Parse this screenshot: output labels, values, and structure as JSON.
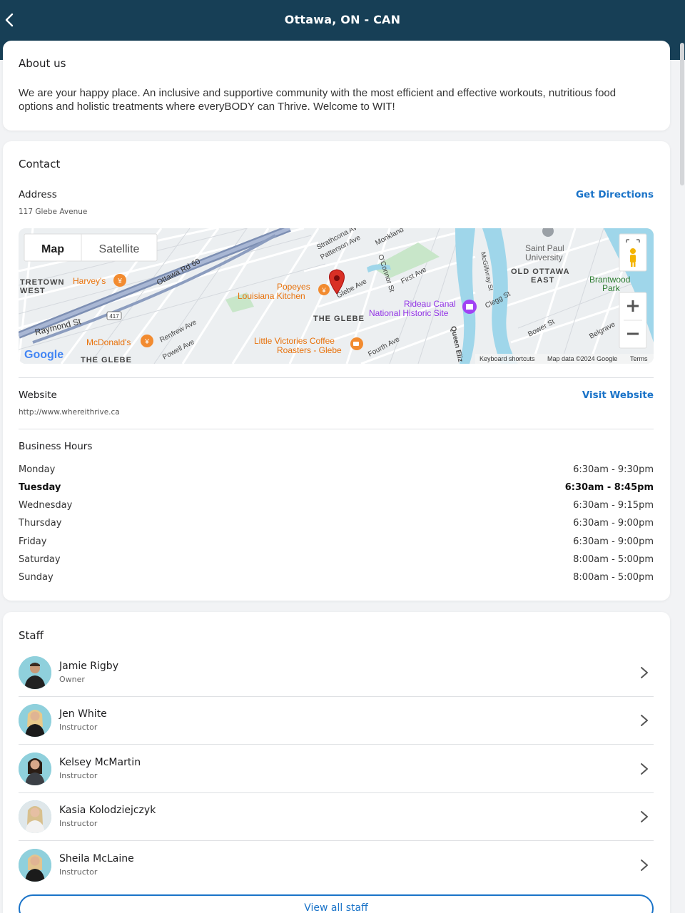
{
  "header": {
    "title": "Ottawa, ON - CAN"
  },
  "about": {
    "title": "About us",
    "text": "We are your happy place. An inclusive and supportive community with the most efficient and effective workouts, nutritious food options and holistic treatments where everyBODY can Thrive. Welcome to WIT!"
  },
  "contact": {
    "title": "Contact",
    "address_label": "Address",
    "address_value": "117 Glebe Avenue",
    "directions_label": "Get Directions",
    "website_label": "Website",
    "website_value": "http://www.whereithrive.ca",
    "visit_label": "Visit Website",
    "hours_label": "Business Hours",
    "hours": [
      {
        "day": "Monday",
        "time": "6:30am - 9:30pm"
      },
      {
        "day": "Tuesday",
        "time": "6:30am - 8:45pm"
      },
      {
        "day": "Wednesday",
        "time": "6:30am - 9:15pm"
      },
      {
        "day": "Thursday",
        "time": "6:30am - 9:00pm"
      },
      {
        "day": "Friday",
        "time": "6:30am - 9:00pm"
      },
      {
        "day": "Saturday",
        "time": "8:00am - 5:00pm"
      },
      {
        "day": "Sunday",
        "time": "8:00am - 5:00pm"
      }
    ],
    "highlighted_day": "Tuesday"
  },
  "map": {
    "tab_map": "Map",
    "tab_satellite": "Satellite",
    "labels": {
      "tretown": "TRETOWN",
      "west": "WEST",
      "harveys": "Harvey's",
      "ottawa_rd": "Ottawa Rd 60",
      "raymond": "Raymond St",
      "hwy": "417",
      "mcdonalds": "McDonald's",
      "renfrew": "Renfrew Ave",
      "powell": "Powell Ave",
      "glebe_bottom": "THE GLEBE",
      "popeyes_1": "Popeyes",
      "popeyes_2": "Louisiana Kitchen",
      "strathcona": "Strathcona Av",
      "patterson": "Patterson Ave",
      "monkland": "Monkland",
      "glebe_ave": "Glebe Ave",
      "oconnor": "O'Connor St",
      "first_ave": "First Ave",
      "the_glebe": "THE GLEBE",
      "rideau_1": "Rideau Canal",
      "rideau_2": "National Historic Site",
      "lv_1": "Little Victories Coffee",
      "lv_2": "Roasters - Glebe",
      "fourth": "Fourth Ave",
      "queen": "Queen Eliz",
      "mcgillivray": "McGillivray St",
      "clegg": "Clegg St",
      "saint_paul_1": "Saint Paul",
      "saint_paul_2": "University",
      "old_ottawa_1": "OLD OTTAWA",
      "old_ottawa_2": "EAST",
      "brantwood_1": "Brantwood",
      "brantwood_2": "Park",
      "bower": "Bower St",
      "belgrave": "Belgrave",
      "google": "Google",
      "shortcuts": "Keyboard shortcuts",
      "mapdata": "Map data ©2024 Google",
      "terms": "Terms"
    }
  },
  "staff": {
    "title": "Staff",
    "members": [
      {
        "name": "Jamie Rigby",
        "role": "Owner"
      },
      {
        "name": "Jen White",
        "role": "Instructor"
      },
      {
        "name": "Kelsey McMartin",
        "role": "Instructor"
      },
      {
        "name": "Kasia Kolodziejczyk",
        "role": "Instructor"
      },
      {
        "name": "Sheila McLaine",
        "role": "Instructor"
      }
    ],
    "view_all_label": "View all staff"
  },
  "colors": {
    "header_bg": "#173f56",
    "link": "#1a73c8",
    "map_pin": "#d93025",
    "water": "#9fd6ea"
  }
}
